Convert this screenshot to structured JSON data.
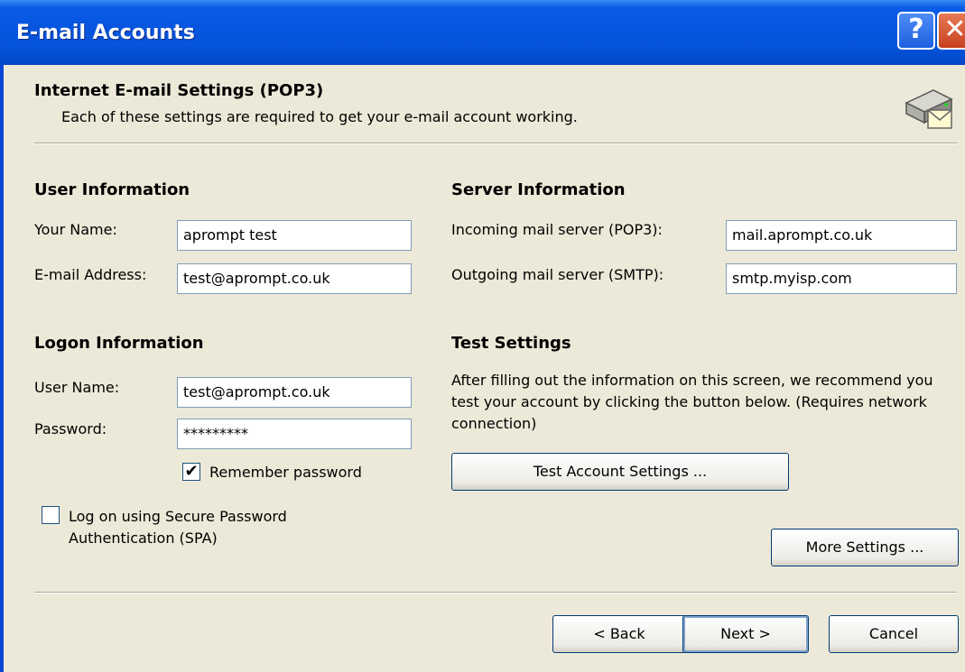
{
  "window": {
    "title": "E-mail Accounts",
    "help_glyph": "?",
    "close_glyph": "✕",
    "accent": "#0554da"
  },
  "header": {
    "title": "Internet E-mail Settings (POP3)",
    "subtitle": "Each of these settings are required to get your e-mail account working."
  },
  "user_info": {
    "heading": "User Information",
    "name_label": "Your Name:",
    "name_value": "aprompt test",
    "email_label": "E-mail Address:",
    "email_value": "test@aprompt.co.uk"
  },
  "server_info": {
    "heading": "Server Information",
    "incoming_label": "Incoming mail server (POP3):",
    "incoming_value": "mail.aprompt.co.uk",
    "outgoing_label": "Outgoing mail server (SMTP):",
    "outgoing_value": "smtp.myisp.com"
  },
  "logon_info": {
    "heading": "Logon Information",
    "username_label": "User Name:",
    "username_value": "test@aprompt.co.uk",
    "password_label": "Password:",
    "password_value": "*********",
    "remember_label": "Remember password",
    "remember_checked": "✔",
    "spa_label": "Log on using Secure Password Authentication (SPA)",
    "spa_checked": ""
  },
  "test_settings": {
    "heading": "Test Settings",
    "description": "After filling out the information on this screen, we recommend you test your account by clicking the button below. (Requires network connection)",
    "test_button": "Test Account Settings ..."
  },
  "buttons": {
    "more_settings": "More Settings ...",
    "back": "< Back",
    "next": "Next >",
    "cancel": "Cancel"
  }
}
